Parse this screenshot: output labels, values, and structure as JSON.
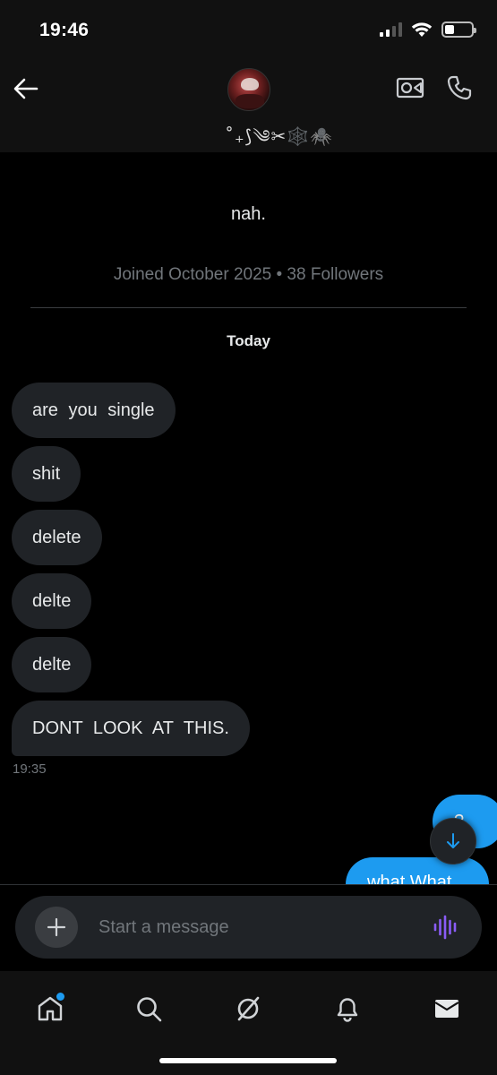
{
  "status_bar": {
    "time": "19:46"
  },
  "header": {
    "display_name": "˚₊⟆༄✂︎🕸️🕷️",
    "icons": [
      "back-arrow-icon",
      "video-camera-icon",
      "phone-icon"
    ]
  },
  "profile": {
    "bio": "nah.",
    "meta": "Joined October 2025 • 38 Followers"
  },
  "conversation": {
    "day_label": "Today",
    "incoming": [
      {
        "text": "are you single"
      },
      {
        "text": "shit"
      },
      {
        "text": "delete"
      },
      {
        "text": "delte"
      },
      {
        "text": "delte"
      },
      {
        "text": "DONT LOOK AT THIS."
      }
    ],
    "incoming_time": "19:35",
    "outgoing": [
      {
        "text": "?"
      },
      {
        "text": "what What"
      }
    ]
  },
  "composer": {
    "placeholder": "Start a message"
  },
  "tab_bar": {
    "tabs": [
      "home-icon",
      "search-icon",
      "grok-icon",
      "notifications-icon",
      "messages-icon"
    ]
  },
  "colors": {
    "accent": "#1d9bf0",
    "bubble_in": "#202327",
    "voice": "#8a5cf6"
  }
}
